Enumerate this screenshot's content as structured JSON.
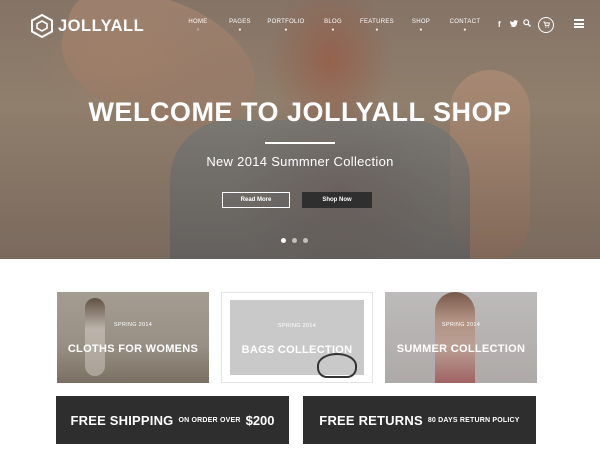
{
  "brand": {
    "name": "JOLLYALL"
  },
  "nav": {
    "items": [
      {
        "label": "HOME"
      },
      {
        "label": "PAGES"
      },
      {
        "label": "PORTFOLIO"
      },
      {
        "label": "BLOG"
      },
      {
        "label": "FEATURES"
      },
      {
        "label": "SHOP"
      },
      {
        "label": "CONTACT"
      }
    ],
    "social": {
      "facebook": "f",
      "twitter": "t",
      "search": "⌕"
    },
    "cart_icon": "cart-icon",
    "menu_icon": "hamburger-menu-icon"
  },
  "hero": {
    "title": "WELCOME TO JOLLYALL SHOP",
    "subtitle": "New 2014 Summner Collection",
    "read_more_label": "Read More",
    "shop_now_label": "Shop Now",
    "slide_count": 3,
    "active_slide": 1
  },
  "categories": [
    {
      "small": "SPRING 2014",
      "title": "CLOTHS FOR WOMENS"
    },
    {
      "small": "SPRING 2014",
      "title": "BAGS COLLECTION"
    },
    {
      "small": "SPRING 2014",
      "title": "SUMMER COLLECTION"
    }
  ],
  "promos": {
    "shipping": {
      "big": "FREE SHIPPING",
      "small": "ON ORDER OVER",
      "amount": "$200"
    },
    "returns": {
      "big": "FREE RETURNS",
      "small": "80 DAYS RETURN POLICY"
    }
  },
  "colors": {
    "dark_bar": "#2e2e2e",
    "white": "#ffffff"
  }
}
